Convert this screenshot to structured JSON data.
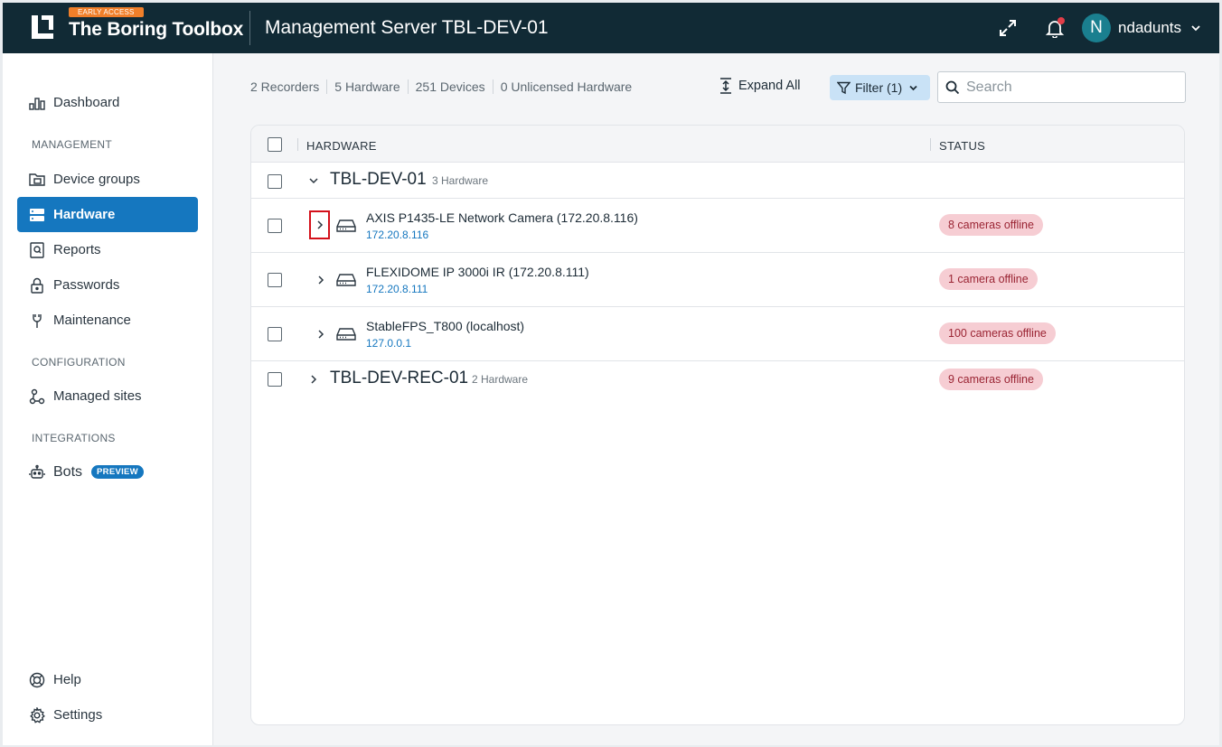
{
  "header": {
    "early_access": "EARLY ACCESS",
    "brand": "The Boring Toolbox",
    "title": "Management Server TBL-DEV-01",
    "user_initial": "N",
    "username": "ndadunts"
  },
  "sidebar": {
    "dashboard": "Dashboard",
    "section_management": "MANAGEMENT",
    "device_groups": "Device groups",
    "hardware": "Hardware",
    "reports": "Reports",
    "passwords": "Passwords",
    "maintenance": "Maintenance",
    "section_configuration": "CONFIGURATION",
    "managed_sites": "Managed sites",
    "section_integrations": "INTEGRATIONS",
    "bots": "Bots",
    "bots_badge": "PREVIEW",
    "help": "Help",
    "settings": "Settings"
  },
  "toolbar": {
    "stats": [
      "2 Recorders",
      "5 Hardware",
      "251 Devices",
      "0 Unlicensed Hardware"
    ],
    "expand_all": "Expand All",
    "filter": "Filter (1)",
    "search_placeholder": "Search"
  },
  "table": {
    "col_hardware": "HARDWARE",
    "col_status": "STATUS",
    "groups": [
      {
        "name": "TBL-DEV-01",
        "count": "3 Hardware",
        "expanded": true,
        "items": [
          {
            "name": "AXIS P1435-LE Network Camera (172.20.8.116)",
            "ip": "172.20.8.116",
            "status": "8 cameras offline"
          },
          {
            "name": "FLEXIDOME IP 3000i IR (172.20.8.111)",
            "ip": "172.20.8.111",
            "status": "1 camera offline"
          },
          {
            "name": "StableFPS_T800 (localhost)",
            "ip": "127.0.0.1",
            "status": "100 cameras offline"
          }
        ]
      },
      {
        "name": "TBL-DEV-REC-01",
        "count": "2 Hardware",
        "expanded": false,
        "status": "9 cameras offline"
      }
    ]
  },
  "colors": {
    "header_bg": "#112a35",
    "accent": "#1577bf",
    "early_access": "#f07f2a",
    "status_bg": "#f6cdd3",
    "status_text": "#9a2433"
  }
}
